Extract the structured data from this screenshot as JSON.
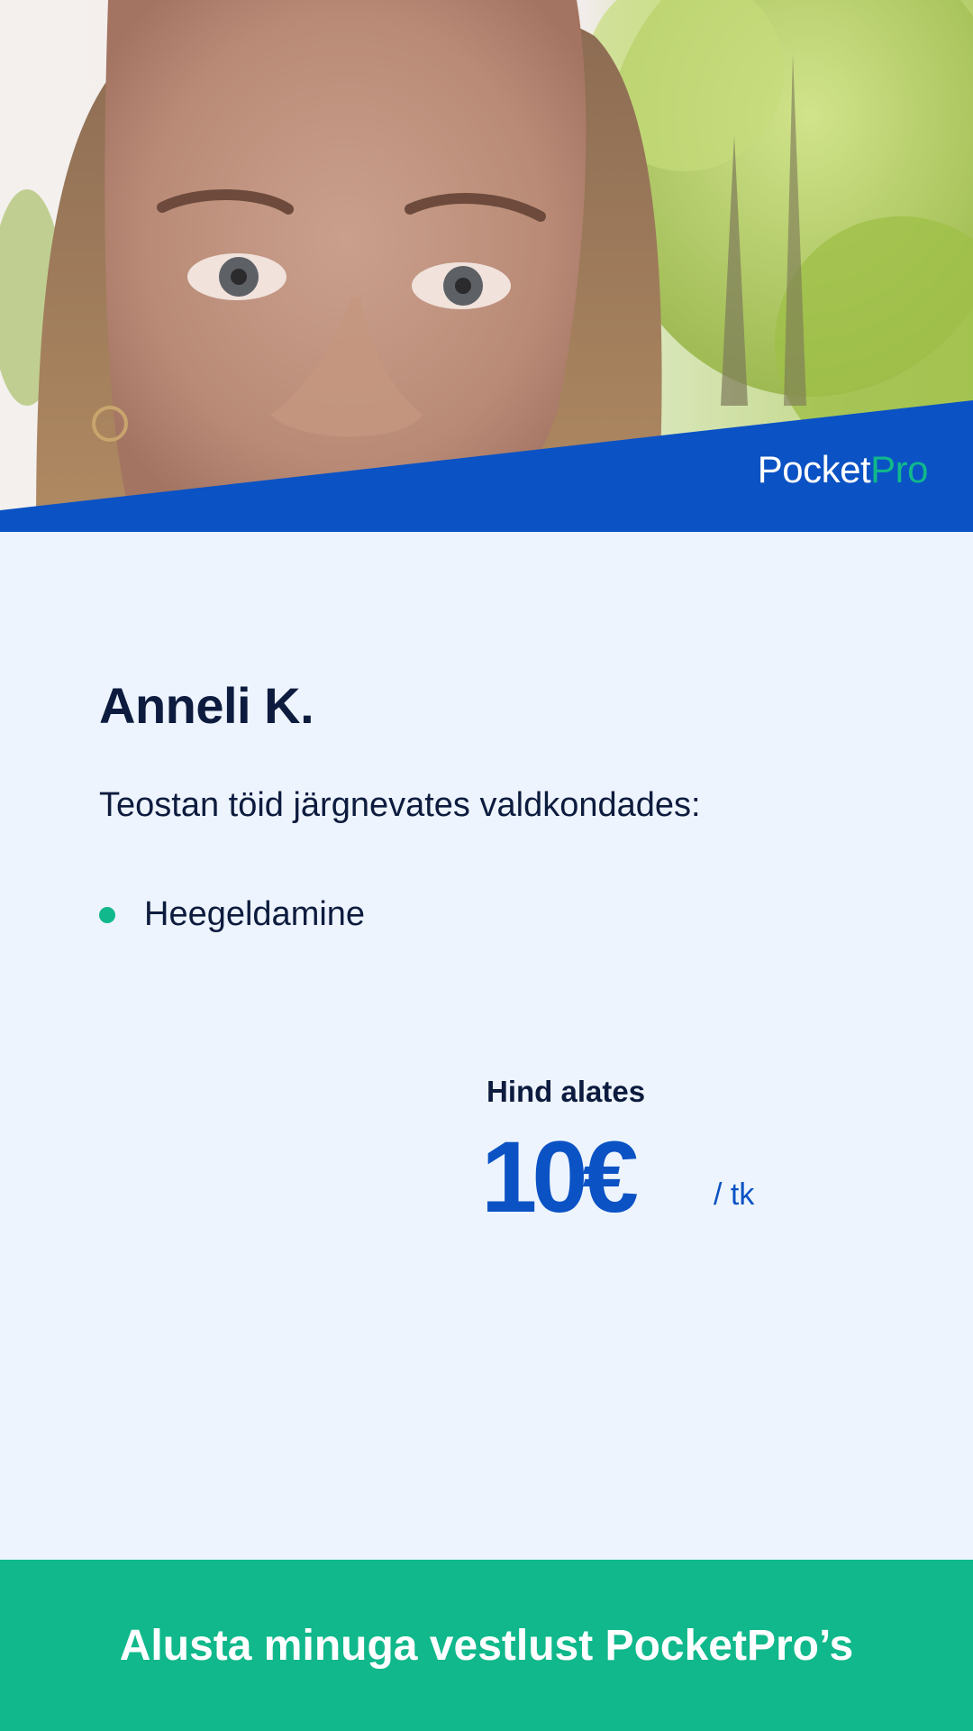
{
  "profile": {
    "photo_alt": "Anneli K.",
    "name": "Anneli K.",
    "intro": "Teostan töid järgnevates valdkondades:",
    "services": [
      "Heegeldamine"
    ]
  },
  "brand": {
    "logo_part_1": "Pocket",
    "logo_part_2": "Pro",
    "band_color": "#0b52c4",
    "accent_color": "#10b88b"
  },
  "price": {
    "label": "Hind alates",
    "value": "10€",
    "unit": "/ tk"
  },
  "cta": {
    "label": "Alusta minuga vestlust PocketPro’s",
    "color": "#10b88b"
  }
}
